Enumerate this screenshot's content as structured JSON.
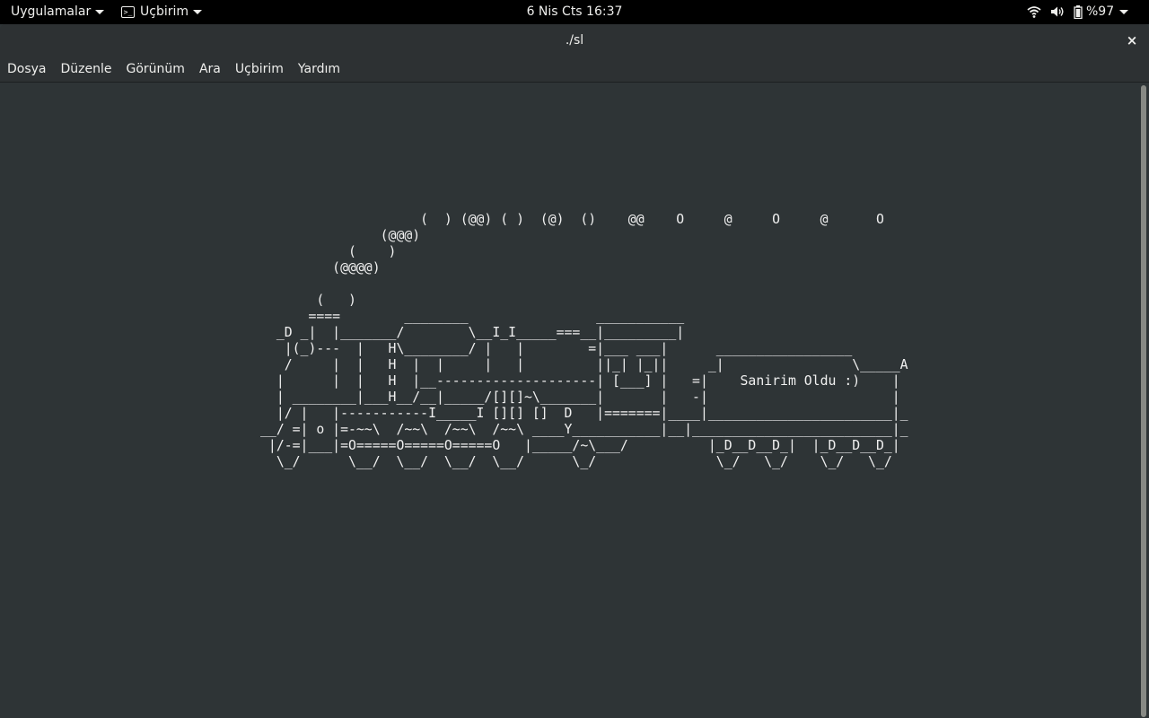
{
  "topbar": {
    "apps_label": "Uygulamalar",
    "app_label": "Uçbirim",
    "clock": "6 Nis Cts  16:37",
    "battery_text": "%97"
  },
  "window": {
    "title": "./sl",
    "close_glyph": "×"
  },
  "menubar": {
    "items": [
      "Dosya",
      "Düzenle",
      "Görünüm",
      "Ara",
      "Uçbirim",
      "Yardım"
    ]
  },
  "terminal": {
    "output": "                    (  ) (@@) ( )  (@)  ()    @@    O     @     O     @      O\n               (@@@)\n           (    )\n         (@@@@)\n\n       (   )\n      ====        ________                ___________\n  _D _|  |_______/        \\__I_I_____===__|_________|\n   |(_)---  |   H\\________/ |   |        =|___ ___|      _________________\n   /     |  |   H  |  |     |   |         ||_| |_||     _|                \\_____A\n  |      |  |   H  |__--------------------| [___] |   =|    Sanirim Oldu :)    |\n  | ________|___H__/__|_____/[][]~\\_______|       |   -|                       |\n  |/ |   |-----------I_____I [][] []  D   |=======|____|_______________________|_\n__/ =| o |=-~~\\  /~~\\  /~~\\  /~~\\ ____Y___________|__|_________________________|_\n |/-=|___|=O=====O=====O=====O   |_____/~\\___/          |_D__D__D_|  |_D__D__D_|\n  \\_/      \\__/  \\__/  \\__/  \\__/      \\_/               \\_/   \\_/    \\_/   \\_/"
  },
  "icons": {
    "terminal": "terminal-icon",
    "wifi": "wifi-icon",
    "volume": "volume-icon",
    "battery": "battery-icon"
  }
}
